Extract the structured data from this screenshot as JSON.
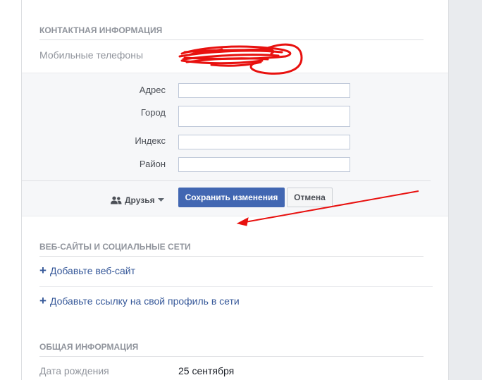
{
  "contact": {
    "heading": "КОНТАКТНАЯ ИНФОРМАЦИЯ",
    "mobile_label": "Мобильные телефоны"
  },
  "edit_form": {
    "fields": [
      {
        "label": "Адрес",
        "value": ""
      },
      {
        "label": "Город",
        "value": ""
      },
      {
        "label": "Индекс",
        "value": ""
      },
      {
        "label": "Район",
        "value": ""
      }
    ],
    "privacy_label": "Друзья",
    "save_label": "Сохранить изменения",
    "cancel_label": "Отмена"
  },
  "websites": {
    "heading": "ВЕБ-САЙТЫ И СОЦИАЛЬНЫЕ СЕТИ",
    "add_website": "Добавьте веб-сайт",
    "add_profile_link": "Добавьте ссылку на свой профиль в сети"
  },
  "general": {
    "heading": "ОБЩАЯ ИНФОРМАЦИЯ",
    "birthday_label": "Дата рождения",
    "birthday_value": "25 сентября"
  },
  "colors": {
    "primary_button": "#4267b2",
    "link": "#365899",
    "annotation": "#e8110f"
  },
  "icons": [
    "friends-icon",
    "caret-down-icon",
    "plus-icon"
  ]
}
